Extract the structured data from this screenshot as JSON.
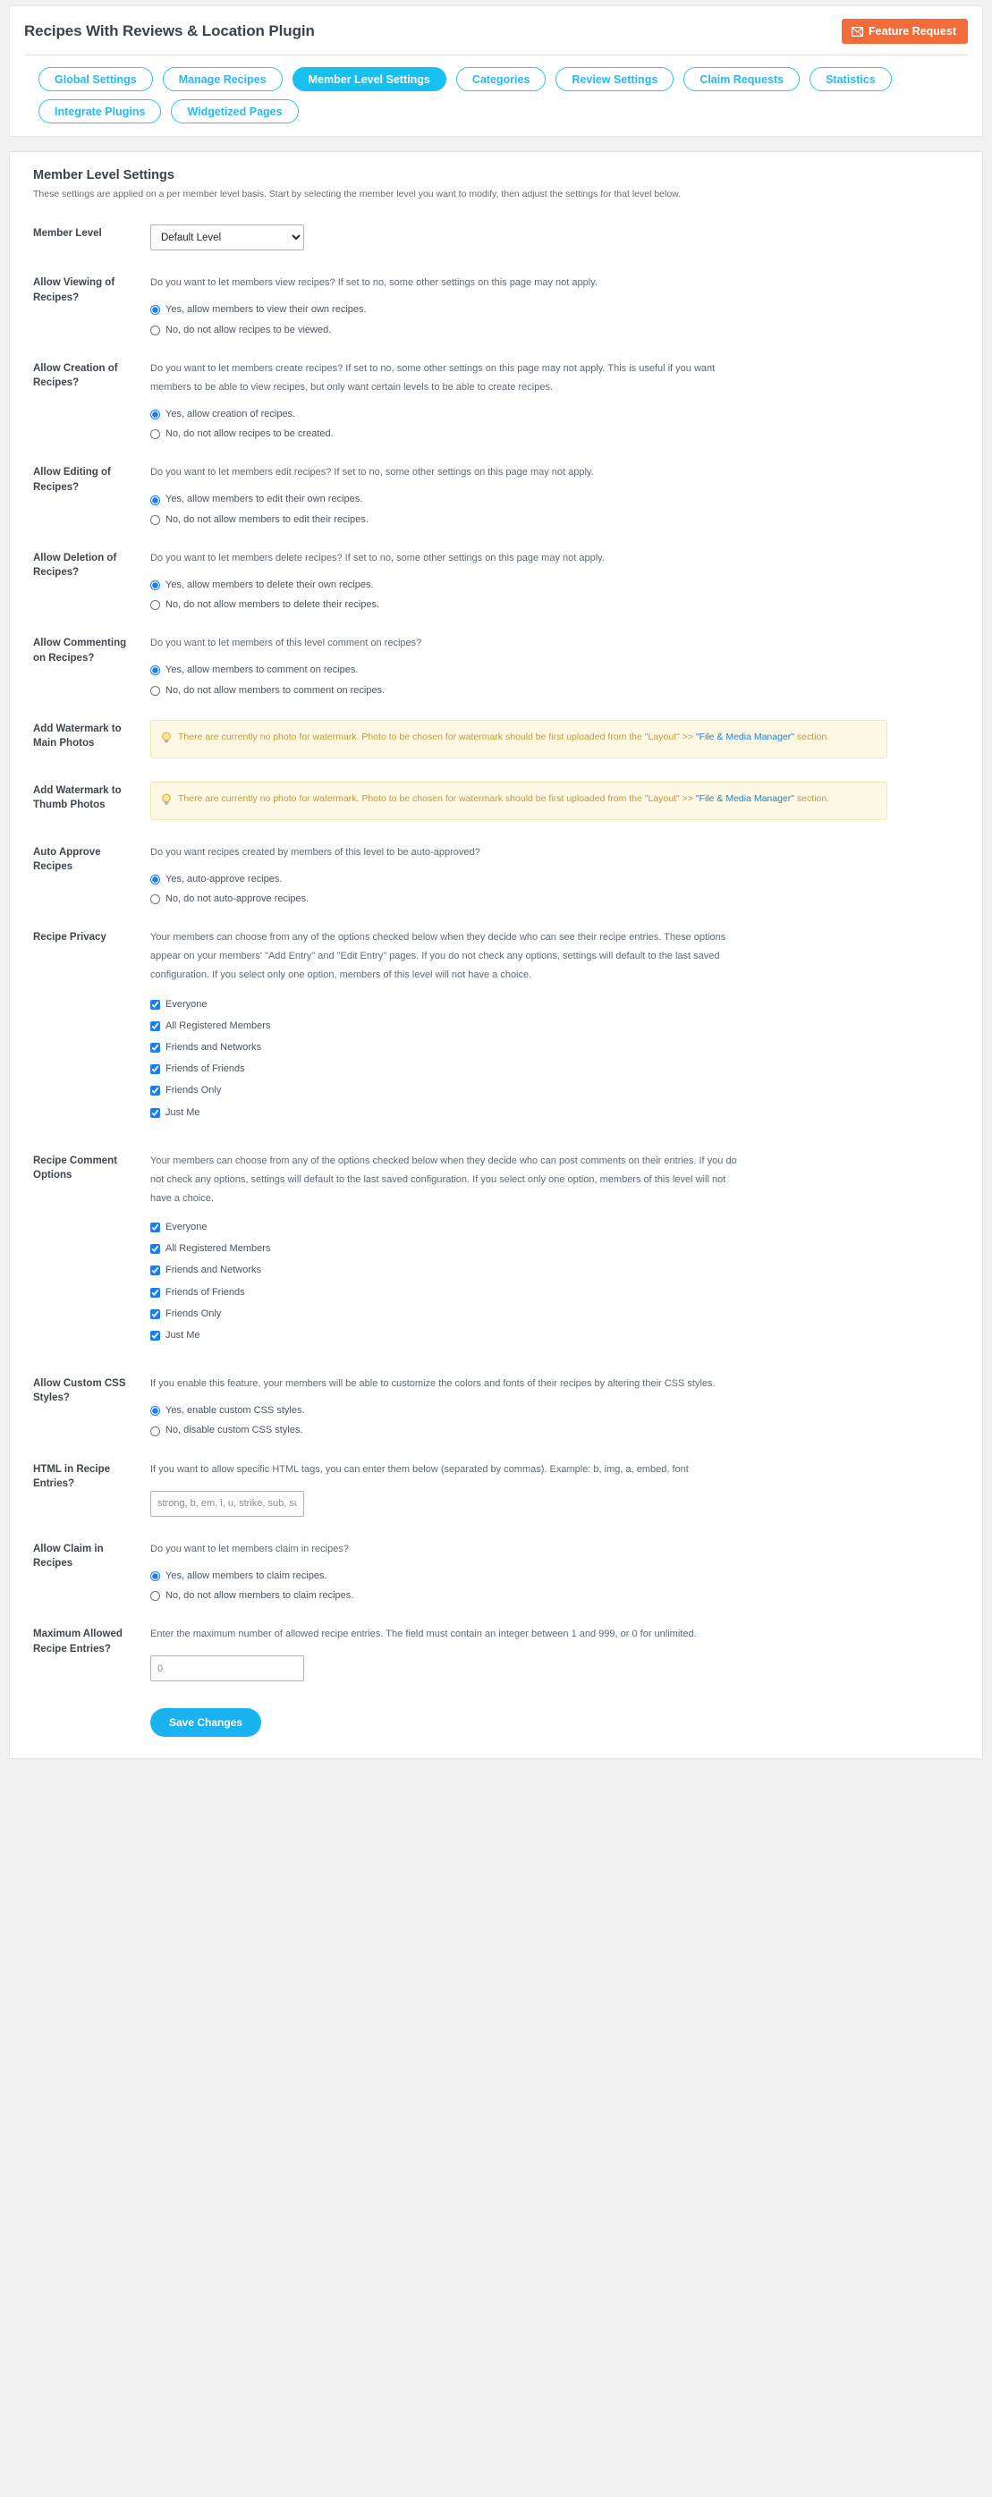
{
  "header": {
    "plugin_title": "Recipes With Reviews & Location Plugin",
    "feature_request_label": "Feature Request"
  },
  "tabs": [
    {
      "label": "Global Settings",
      "active": false
    },
    {
      "label": "Manage Recipes",
      "active": false
    },
    {
      "label": "Member Level Settings",
      "active": true
    },
    {
      "label": "Categories",
      "active": false
    },
    {
      "label": "Review Settings",
      "active": false
    },
    {
      "label": "Claim Requests",
      "active": false
    },
    {
      "label": "Statistics",
      "active": false
    },
    {
      "label": "Integrate Plugins",
      "active": false
    },
    {
      "label": "Widgetized Pages",
      "active": false
    }
  ],
  "section": {
    "title": "Member Level Settings",
    "subtitle": "These settings are applied on a per member level basis. Start by selecting the member level you want to modify, then adjust the settings for that level below."
  },
  "member_level": {
    "label": "Member Level",
    "selected": "Default Level",
    "options": [
      "Default Level"
    ]
  },
  "viewing": {
    "label": "Allow Viewing of Recipes?",
    "desc": "Do you want to let members view recipes? If set to no, some other settings on this page may not apply.",
    "yes": "Yes, allow members to view their own recipes.",
    "no": "No, do not allow recipes to be viewed.",
    "selected": "yes"
  },
  "creation": {
    "label": "Allow Creation of Recipes?",
    "desc": "Do you want to let members create recipes? If set to no, some other settings on this page may not apply. This is useful if you want members to be able to view recipes, but only want certain levels to be able to create recipes.",
    "yes": "Yes, allow creation of recipes.",
    "no": "No, do not allow recipes to be created.",
    "selected": "yes"
  },
  "editing": {
    "label": "Allow Editing of Recipes?",
    "desc": "Do you want to let members edit recipes? If set to no, some other settings on this page may not apply.",
    "yes": "Yes, allow members to edit their own recipes.",
    "no": "No, do not allow members to edit their recipes.",
    "selected": "yes"
  },
  "deletion": {
    "label": "Allow Deletion of Recipes?",
    "desc": "Do you want to let members delete recipes? If set to no, some other settings on this page may not apply.",
    "yes": "Yes, allow members to delete their own recipes.",
    "no": "No, do not allow members to delete their recipes.",
    "selected": "yes"
  },
  "commenting": {
    "label": "Allow Commenting on Recipes?",
    "desc": "Do you want to let members of this level comment on recipes?",
    "yes": "Yes, allow members to comment on recipes.",
    "no": "No, do not allow members to comment on recipes.",
    "selected": "yes"
  },
  "watermark_main": {
    "label": "Add Watermark to Main Photos",
    "note_before": "There are currently no photo for watermark. Photo to be chosen for watermark should be first uploaded from the \"Layout\" >> ",
    "note_link": "\"File & Media Manager\"",
    "note_after": " section."
  },
  "watermark_thumb": {
    "label": "Add Watermark to Thumb Photos",
    "note_before": "There are currently no photo for watermark. Photo to be chosen for watermark should be first uploaded from the \"Layout\" >> ",
    "note_link": "\"File & Media Manager\"",
    "note_after": " section."
  },
  "auto_approve": {
    "label": "Auto Approve Recipes",
    "desc": "Do you want recipes created by members of this level to be auto-approved?",
    "yes": "Yes, auto-approve recipes.",
    "no": "No, do not auto-approve recipes.",
    "selected": "yes"
  },
  "recipe_privacy": {
    "label": "Recipe Privacy",
    "desc": "Your members can choose from any of the options checked below when they decide who can see their recipe entries. These options appear on your members' \"Add Entry\" and \"Edit Entry\" pages. If you do not check any options, settings will default to the last saved configuration. If you select only one option, members of this level will not have a choice.",
    "options": [
      {
        "label": "Everyone",
        "checked": true
      },
      {
        "label": "All Registered Members",
        "checked": true
      },
      {
        "label": "Friends and Networks",
        "checked": true
      },
      {
        "label": "Friends of Friends",
        "checked": true
      },
      {
        "label": "Friends Only",
        "checked": true
      },
      {
        "label": "Just Me",
        "checked": true
      }
    ]
  },
  "comment_options": {
    "label": "Recipe Comment Options",
    "desc": "Your members can choose from any of the options checked below when they decide who can post comments on their entries. If you do not check any options, settings will default to the last saved configuration. If you select only one option, members of this level will not have a choice.",
    "options": [
      {
        "label": "Everyone",
        "checked": true
      },
      {
        "label": "All Registered Members",
        "checked": true
      },
      {
        "label": "Friends and Networks",
        "checked": true
      },
      {
        "label": "Friends of Friends",
        "checked": true
      },
      {
        "label": "Friends Only",
        "checked": true
      },
      {
        "label": "Just Me",
        "checked": true
      }
    ]
  },
  "custom_css": {
    "label": "Allow Custom CSS Styles?",
    "desc": "If you enable this feature, your members will be able to customize the colors and fonts of their recipes by altering their CSS styles.",
    "yes": "Yes, enable custom CSS styles.",
    "no": "No, disable custom CSS styles.",
    "selected": "yes"
  },
  "html_entries": {
    "label": "HTML in Recipe Entries?",
    "desc": "If you want to allow specific HTML tags, you can enter them below (separated by commas). Example: b, img, a, embed, font",
    "value": "",
    "placeholder": "strong, b, em, i, u, strike, sub, sup, p, div, pre"
  },
  "claim": {
    "label": "Allow Claim in Recipes",
    "desc": "Do you want to let members claim in recipes?",
    "yes": "Yes, allow members to claim recipes.",
    "no": "No, do not allow members to claim recipes.",
    "selected": "yes"
  },
  "max_entries": {
    "label": "Maximum Allowed Recipe Entries?",
    "desc": "Enter the maximum number of allowed recipe entries. The field must contain an integer between 1 and 999, or 0 for unlimited.",
    "value": "",
    "placeholder": "0"
  },
  "save": {
    "label": "Save Changes"
  },
  "colors": {
    "accent": "#18c0f0",
    "feature_request": "#f26b38",
    "note_bg": "#fdf8e3",
    "note_text": "#c19a3e",
    "link": "#2a7fc9"
  }
}
